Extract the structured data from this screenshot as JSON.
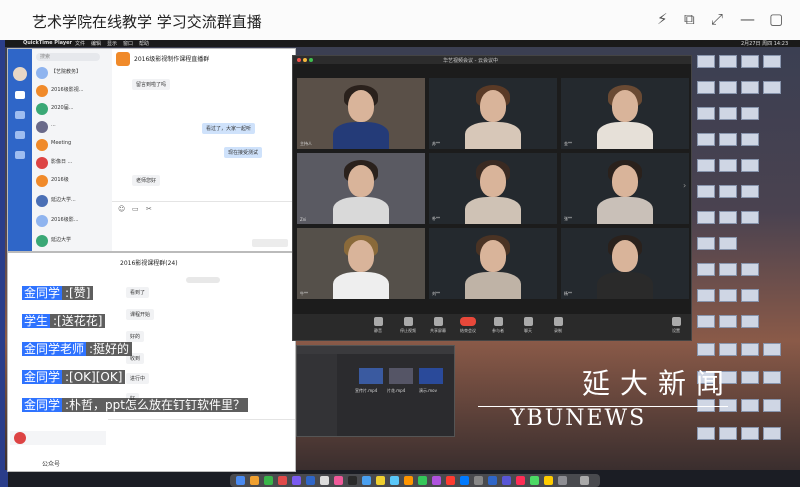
{
  "window": {
    "title": "艺术学院在线教学 学习交流群直播"
  },
  "menubar": {
    "app": "QuickTime Player",
    "items": [
      "文件",
      "编辑",
      "显示",
      "窗口",
      "帮助"
    ],
    "time": "2月27日 周四 14:23"
  },
  "dingtalk": {
    "search_placeholder": "搜索",
    "group_title": "2016级影视制作课程直播群",
    "conversations": [
      "【艺院教务】",
      "2016级影视...",
      "2020届...",
      "...",
      "Meeting",
      "影像日 ...",
      "2016级",
      "延边大学...",
      "2016级影...",
      "延边大学"
    ],
    "messages": [
      {
        "side": "left",
        "text": "留言到啦了吗"
      },
      {
        "side": "right",
        "text": "看过了，大家一起听"
      },
      {
        "side": "right",
        "text": "现在接受测试"
      },
      {
        "side": "left",
        "text": "老师您好"
      }
    ]
  },
  "dingtalk2": {
    "title": "2016影视课程群(24)",
    "messages": [
      "看到了",
      "课程开始",
      "好的",
      "收到",
      "进行中",
      "好"
    ],
    "bottom_label": "公众号"
  },
  "zoom": {
    "title": "华艺视频会议 - 云会议中",
    "participants": [
      {
        "name": "主持人"
      },
      {
        "name": "苏**"
      },
      {
        "name": "金**"
      },
      {
        "name": "Zni"
      },
      {
        "name": "朴**"
      },
      {
        "name": "张**"
      },
      {
        "name": "牛**"
      },
      {
        "name": "刘**"
      },
      {
        "name": "杨**"
      }
    ],
    "toolbar": [
      "静音",
      "停止视频",
      "共享屏幕",
      "结束会议",
      "参与者",
      "聊天",
      "录制",
      "设置"
    ]
  },
  "finder": {
    "files": [
      "宣传片.mp4",
      "片花.mp4",
      "演示.mov"
    ]
  },
  "danmaku": [
    {
      "user": "金同学",
      "text": ":[赞]"
    },
    {
      "user": "学生",
      "text": ":[送花花]"
    },
    {
      "user": "金同学老师",
      "text": ":挺好的"
    },
    {
      "user": "金同学",
      "text": ":[OK][OK]"
    },
    {
      "user": "金同学",
      "text": ":朴哲，ppt怎么放在钉钉软件里？"
    }
  ],
  "logo": {
    "cn": "延大新闻",
    "en": "YBUNEWS"
  },
  "colors": {
    "dingtalk_blue": "#2f66c8",
    "danmaku_user_bg": "#2f73ff",
    "end_meeting": "#e8483a"
  }
}
